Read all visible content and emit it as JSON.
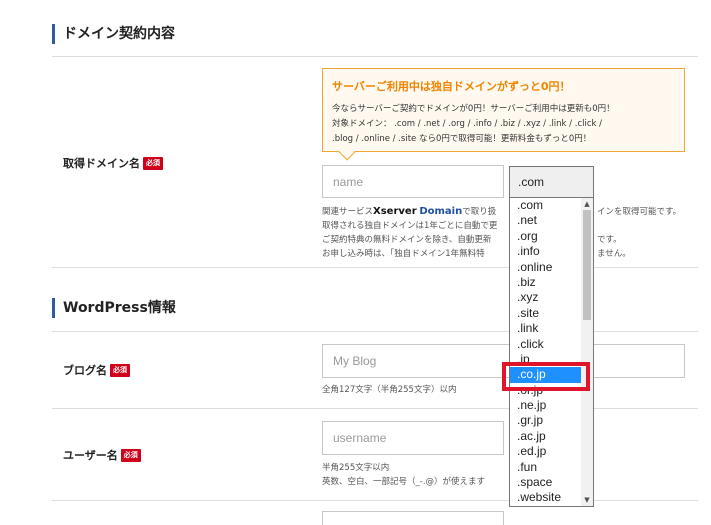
{
  "domain_section": {
    "title": "ドメイン契約内容",
    "label": "取得ドメイン名",
    "required": "必須",
    "promo": {
      "title": "サーバーご利用中は独自ドメインがずっと0円！",
      "line1": "今ならサーバーご契約でドメインが0円！サーバーご利用中は更新も0円！",
      "line2": "対象ドメイン： .com / .net / .org / .info / .biz / .xyz / .link / .click /",
      "line3": ".blog / .online / .site なら0円で取得可能！更新料金もずっと0円！"
    },
    "name_placeholder": "name",
    "selected_tld": ".com",
    "help": {
      "line1_prefix": "関連サービス",
      "brand_x": "Xserver",
      "brand_d": "Domain",
      "line1_suffix": "で取り扱",
      "line1_tail": "インを取得可能です。",
      "line2": "取得される独自ドメインは1年ごとに自動で更",
      "line3": "ご契約特典の無料ドメインを除き、自動更新",
      "line3_tail": "です。",
      "line4": "お申し込み時は、「独自ドメイン1年無料特",
      "line4_tail": "ません。"
    },
    "tld_options": [
      ".com",
      ".net",
      ".org",
      ".info",
      ".online",
      ".biz",
      ".xyz",
      ".site",
      ".link",
      ".click",
      ".jp",
      ".co.jp",
      ".or.jp",
      ".ne.jp",
      ".gr.jp",
      ".ac.jp",
      ".ed.jp",
      ".fun",
      ".space",
      ".website"
    ],
    "highlighted_option": ".co.jp"
  },
  "wordpress_section": {
    "title": "WordPress情報",
    "blog_label": "ブログ名",
    "blog_placeholder": "My Blog",
    "blog_help": "全角127文字（半角255文字）以内",
    "user_label": "ユーザー名",
    "user_placeholder": "username",
    "user_help1": "半角255文字以内",
    "user_help2": "英数、空白、一部記号（_-.@）が使えます",
    "required": "必須"
  },
  "icons": {
    "scroll_up": "triangle-up-icon",
    "scroll_down": "triangle-down-icon"
  },
  "colors": {
    "accent": "#2f5d9a",
    "required": "#d0021b",
    "promo": "#f08300",
    "selection": "#1e90ff",
    "highlight": "#e0142b"
  }
}
